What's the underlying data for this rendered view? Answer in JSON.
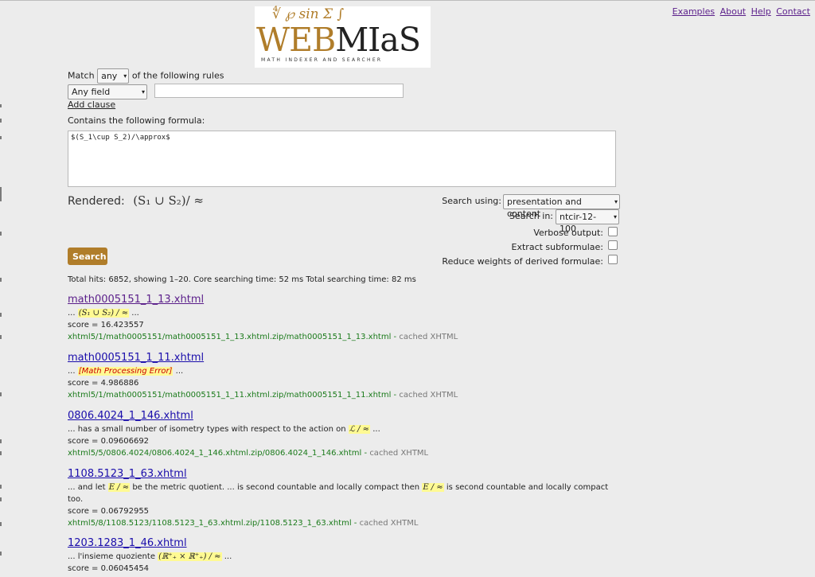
{
  "nav": {
    "examples": "Examples",
    "about": "About",
    "help": "Help",
    "contact": "Contact"
  },
  "logo": {
    "symbols": "∜  ℘  sin  Σ  ∫",
    "web": "WEB",
    "mias": "MIaS",
    "tagline": "MATH INDEXER AND SEARCHER"
  },
  "form": {
    "match_prefix": "Match",
    "match_value": "any",
    "match_suffix": "of the following rules",
    "field_value": "Any field",
    "text_value": "",
    "add_clause": "Add clause",
    "contains_label": "Contains the following formula:",
    "formula": "$(S_1\\cup S_2)/\\approx$",
    "rendered_label": "Rendered:",
    "rendered_math": "(S₁ ∪ S₂)/ ≈",
    "search_using_label": "Search using:",
    "search_using_value": "presentation and content",
    "search_in_label": "Search in:",
    "search_in_value": "ntcir-12-100",
    "verbose_label": "Verbose output:",
    "extract_label": "Extract subformulae:",
    "reduce_label": "Reduce weights of derived formulae:",
    "search_button": "Search"
  },
  "summary": "Total hits: 6852, showing 1–20. Core searching time: 52 ms Total searching time: 82 ms",
  "results": [
    {
      "title": "math0005151_1_13.xhtml",
      "pre": "... ",
      "math": "(S₁ ∪ S₂) / ≈",
      "post": " ...",
      "score": "score = 16.423557",
      "url": "xhtml5/1/math0005151/math0005151_1_13.xhtml.zip/math0005151_1_13.xhtml",
      "cached": "cached XHTML"
    },
    {
      "title": "math0005151_1_11.xhtml",
      "pre": "... ",
      "error": "[Math Processing Error]",
      "post": " ...",
      "score": "score = 4.986886",
      "url": "xhtml5/1/math0005151/math0005151_1_11.xhtml.zip/math0005151_1_11.xhtml",
      "cached": "cached XHTML"
    },
    {
      "title": "0806.4024_1_146.xhtml",
      "pre": "... has a small number of isometry types with respect to the action on ",
      "math": "ℒ / ≈",
      "post": " ...",
      "score": "score = 0.09606692",
      "url": "xhtml5/5/0806.4024/0806.4024_1_146.xhtml.zip/0806.4024_1_146.xhtml",
      "cached": "cached XHTML"
    },
    {
      "title": "1108.5123_1_63.xhtml",
      "pre": "... and let ",
      "math": "E / ≈",
      "mid": " be the metric quotient. ... is second countable and locally compact then ",
      "math2": "E / ≈",
      "post": " is second countable and locally compact too.",
      "score": "score = 0.06792955",
      "url": "xhtml5/8/1108.5123/1108.5123_1_63.xhtml.zip/1108.5123_1_63.xhtml",
      "cached": "cached XHTML"
    },
    {
      "title": "1203.1283_1_46.xhtml",
      "pre": "... l'insieme quoziente ",
      "math": "(ℝ⁺₊ × ℝ⁺₊) / ≈",
      "post": " ...",
      "score": "score = 0.06045454"
    }
  ]
}
